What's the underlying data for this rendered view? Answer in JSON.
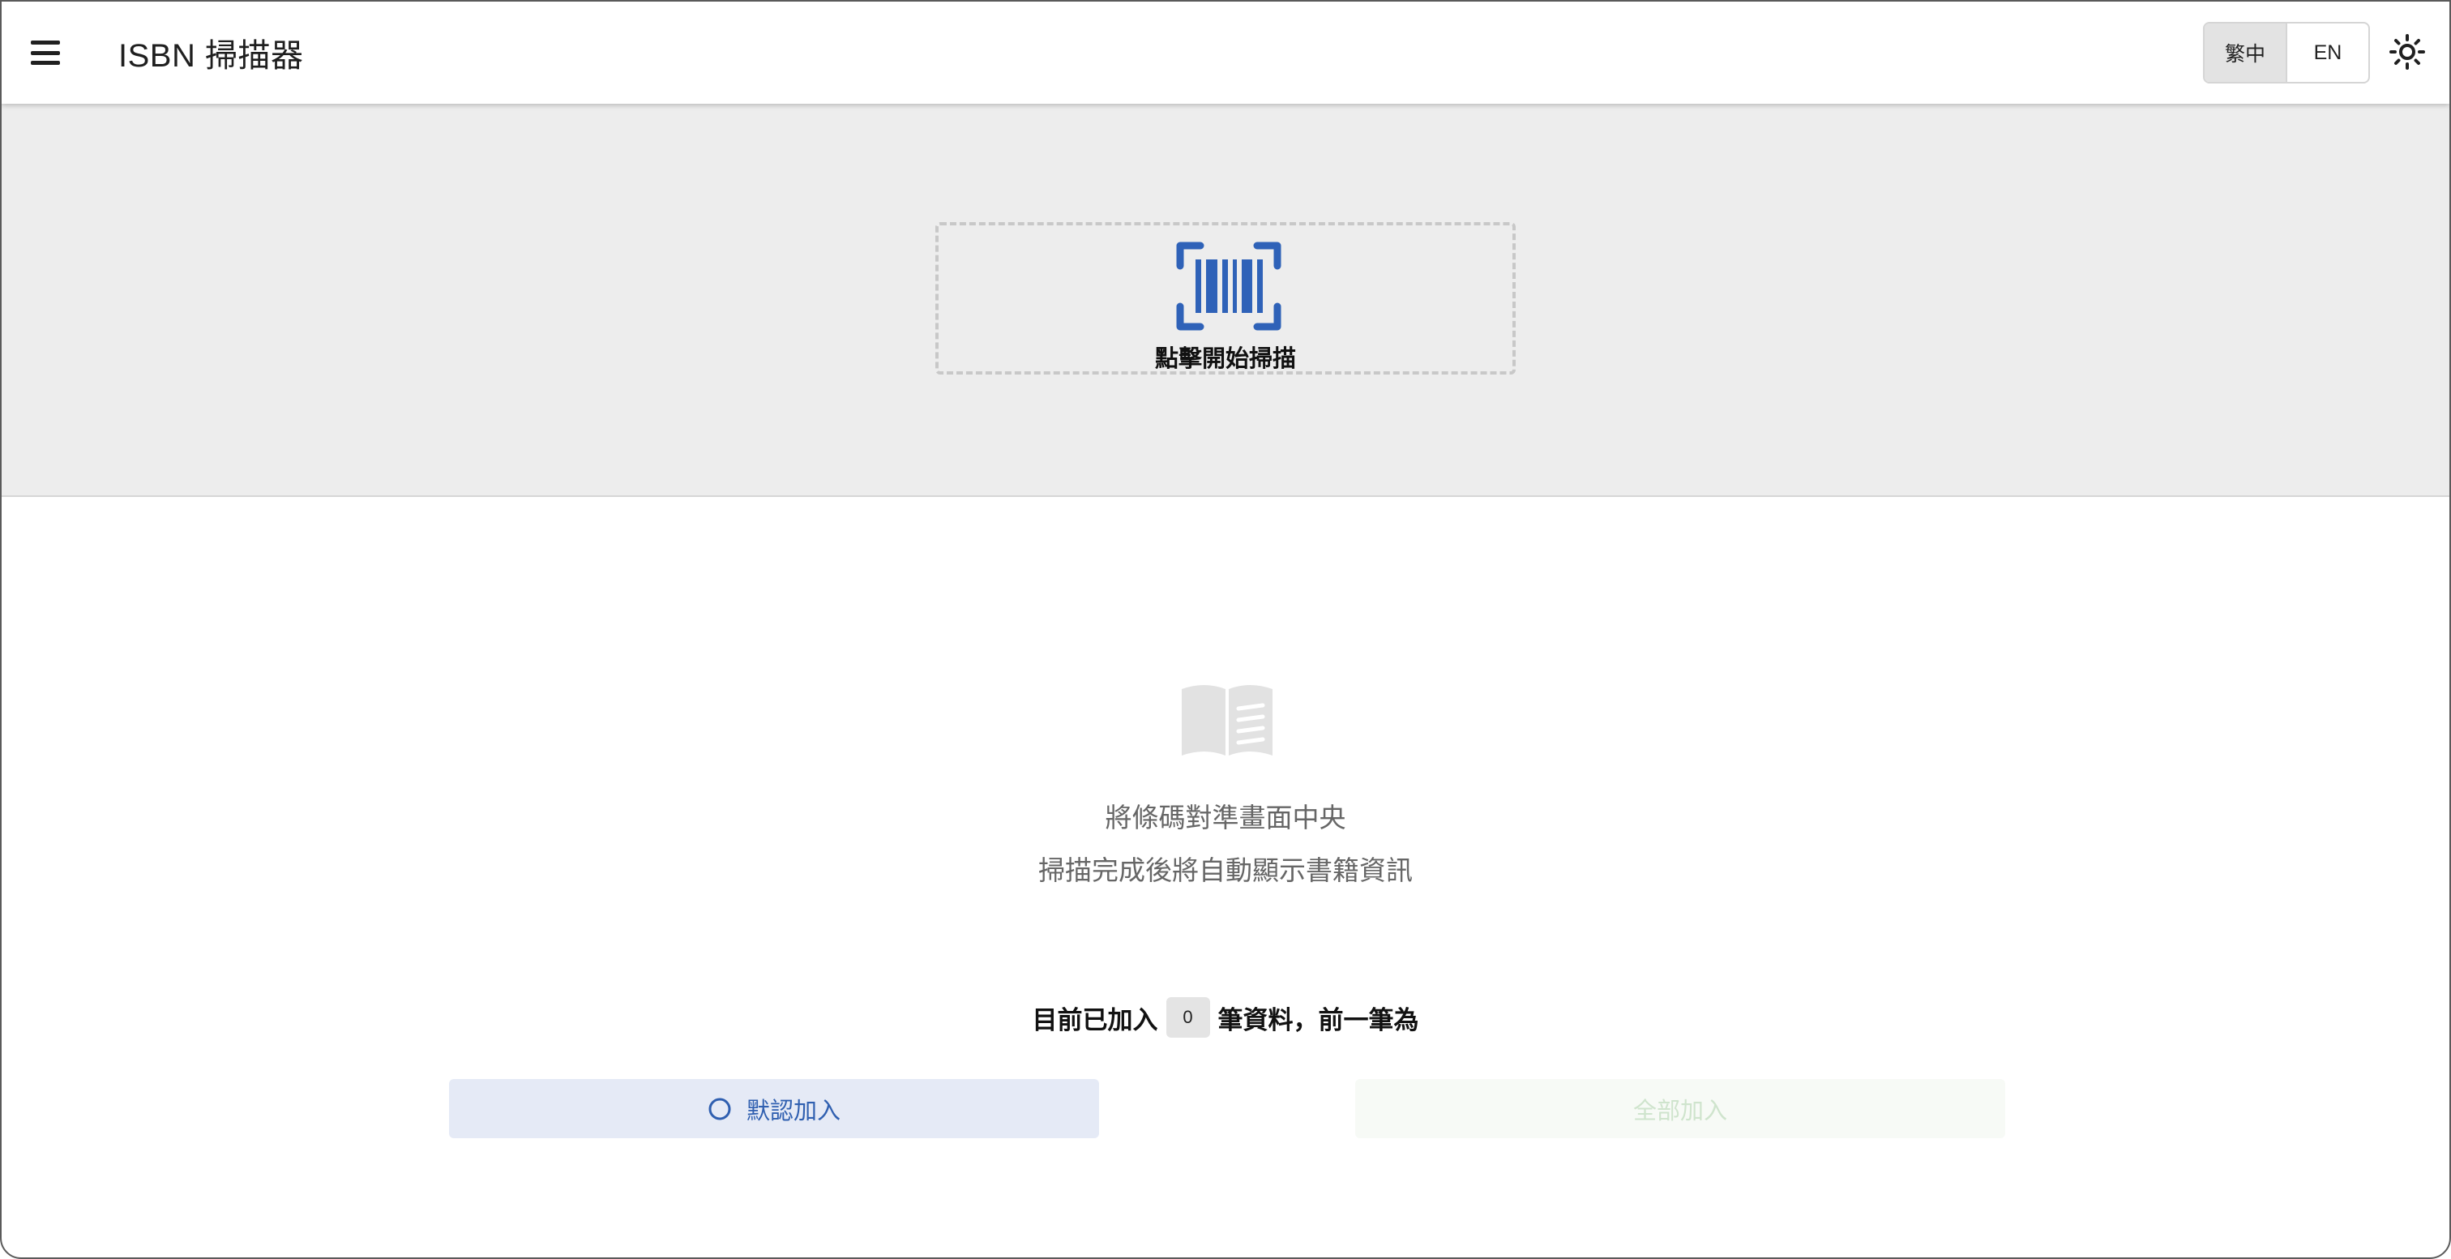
{
  "app_bar": {
    "title": "ISBN 掃描器",
    "menu_icon": "hamburger-menu-icon",
    "language_options": [
      {
        "label": "繁中",
        "selected": true
      },
      {
        "label": "EN",
        "selected": false
      }
    ],
    "theme_icon": "brightness-icon"
  },
  "scanner": {
    "icon": "barcode-scan-icon",
    "start_label": "點擊開始掃描",
    "accent_color": "#2f62b8"
  },
  "empty_state": {
    "icon": "open-book-icon",
    "line_1": "將條碼對準畫面中央",
    "line_2": "掃描完成後將自動顯示書籍資訊"
  },
  "count": {
    "prefix": "目前已加入",
    "value": "0",
    "suffix": "筆資料，前一筆為"
  },
  "actions": {
    "default_add_label": "默認加入",
    "default_add_icon": "radio-circle-icon",
    "add_all_label": "全部加入",
    "add_all_enabled": false
  }
}
